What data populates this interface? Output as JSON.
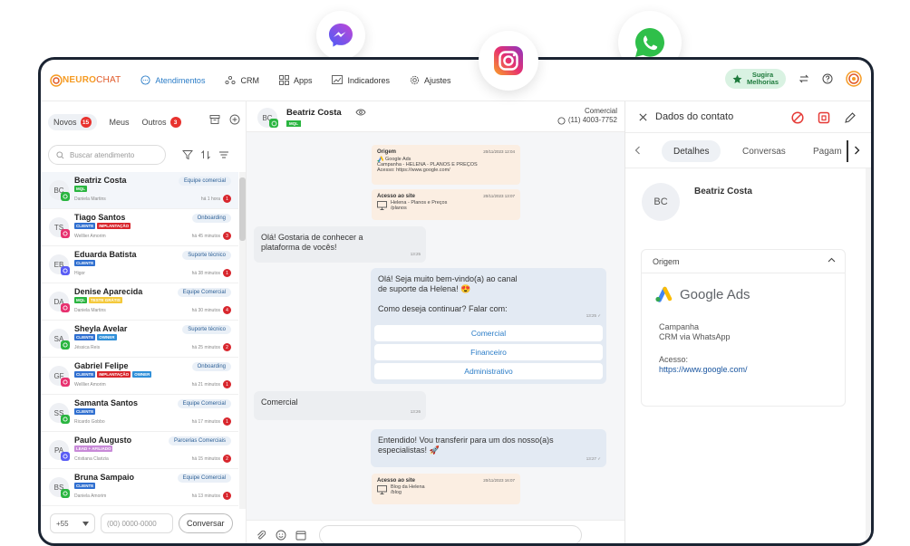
{
  "app": {
    "logo_brand": "NEURO",
    "logo_suffix": "CHAT",
    "nav": {
      "atendimentos": "Atendimentos",
      "crm": "CRM",
      "apps": "Apps",
      "indicadores": "Indicadores",
      "ajustes": "Ajustes"
    },
    "sugira_line1": "Sugira",
    "sugira_line2": "Melhorias"
  },
  "left": {
    "tabs": {
      "novos": "Novos",
      "novos_count": "15",
      "meus": "Meus",
      "outros": "Outros",
      "outros_count": "3"
    },
    "search_placeholder": "Buscar atendimento",
    "conversations": [
      {
        "initials": "BC",
        "name": "Beatriz Costa",
        "tags": [
          {
            "text": "MQL",
            "color": "#2ab540"
          }
        ],
        "agent": "Daniela Martins",
        "team": "Equipe comercial",
        "time": "há 1 hora",
        "count": "1",
        "channel": "whatsapp"
      },
      {
        "initials": "TS",
        "name": "Tiago Santos",
        "tags": [
          {
            "text": "CLIENTE",
            "color": "#2f6fd0"
          },
          {
            "text": "IMPLANTAÇÃO",
            "color": "#d8262d"
          }
        ],
        "agent": "Welllier Amorim",
        "team": "Onboarding",
        "time": "há 45 minutos",
        "count": "3",
        "channel": "instagram"
      },
      {
        "initials": "EB",
        "name": "Eduarda Batista",
        "tags": [
          {
            "text": "CLIENTE",
            "color": "#2f6fd0"
          }
        ],
        "agent": "Higor",
        "team": "Suporte técnico",
        "time": "há 38 minutos",
        "count": "1",
        "channel": "messenger"
      },
      {
        "initials": "DA",
        "name": "Denise Aparecida",
        "tags": [
          {
            "text": "MQL",
            "color": "#2ab540"
          },
          {
            "text": "TESTE GRÁTIS",
            "color": "#f4c93b"
          }
        ],
        "agent": "Daniela Martins",
        "team": "Equipe Comercial",
        "time": "há 30 minutos",
        "count": "4",
        "channel": "instagram"
      },
      {
        "initials": "SA",
        "name": "Sheyla Avelar",
        "tags": [
          {
            "text": "CLIENTE",
            "color": "#2f6fd0"
          },
          {
            "text": "OWNER",
            "color": "#2f8fd8"
          }
        ],
        "agent": "Jéssica Reis",
        "team": "Suporte técnico",
        "time": "há 25 minutos",
        "count": "2",
        "channel": "whatsapp"
      },
      {
        "initials": "GF",
        "name": "Gabriel Felipe",
        "tags": [
          {
            "text": "CLIENTE",
            "color": "#2f6fd0"
          },
          {
            "text": "IMPLANTAÇÃO",
            "color": "#d8262d"
          },
          {
            "text": "OWNER",
            "color": "#2f8fd8"
          }
        ],
        "agent": "Welllier Amorim",
        "team": "Onboarding",
        "time": "há 21 minutos",
        "count": "1",
        "channel": "instagram"
      },
      {
        "initials": "SS",
        "name": "Samanta Santos",
        "tags": [
          {
            "text": "CLIENTE",
            "color": "#2f6fd0"
          }
        ],
        "agent": "Ricardo Gobbo",
        "team": "Equipe Comercial",
        "time": "há 17 minutos",
        "count": "1",
        "channel": "whatsapp"
      },
      {
        "initials": "PA",
        "name": "Paulo Augusto",
        "tags": [
          {
            "text": "LEAD + AFILIADO",
            "color": "#c88ad8"
          }
        ],
        "agent": "Cristiana Clarizia",
        "team": "Parcerias Comerciais",
        "time": "há 15 minutos",
        "count": "2",
        "channel": "messenger"
      },
      {
        "initials": "BS",
        "name": "Bruna Sampaio",
        "tags": [
          {
            "text": "CLIENTE",
            "color": "#2f6fd0"
          }
        ],
        "agent": "Daniela Amorim",
        "team": "Equipe Comercial",
        "time": "há 13 minutos",
        "count": "1",
        "channel": "whatsapp"
      }
    ],
    "ddi": "+55",
    "phone_placeholder": "(00) 0000-0000",
    "conversar": "Conversar"
  },
  "chat": {
    "contact_initials": "BC",
    "contact_name": "Beatriz Costa",
    "contact_tag": "MQL",
    "dept": "Comercial",
    "phone": "(11) 4003-7752",
    "origin_box": {
      "title": "Origem",
      "date": "20/11/2023 12:04",
      "source": "Google Ads",
      "campaign": "Campanha - HELENA - PLANOS E PREÇOS",
      "access": "Acesso: https://www.google.com/"
    },
    "site_box_1": {
      "title": "Acesso ao site",
      "date": "20/11/2023 13:07",
      "line1": "Helena - Planos e Preços",
      "line2": "/planos"
    },
    "msg_in_1": {
      "line1": "Olá! Gostaria de conhecer a",
      "line2": "plataforma de vocês!",
      "time": "13:25"
    },
    "msg_out_1": {
      "line1": "Olá! Seja muito bem-vindo(a) ao canal",
      "line2": "de suporte da Helena! 😍",
      "line3": "Como deseja continuar? Falar com:",
      "time": "13:25 ✓",
      "options": [
        "Comercial",
        "Financeiro",
        "Administrativo"
      ]
    },
    "msg_in_2": {
      "text": "Comercial",
      "time": "13:26"
    },
    "msg_out_2": {
      "line1": "Entendido! Vou transferir para um dos nosso(a)s",
      "line2": "especialistas! 🚀",
      "time": "13:27 ✓"
    },
    "site_box_2": {
      "title": "Acesso ao site",
      "date": "20/11/2023 16:07",
      "line1": "Blog da Helena",
      "line2": "/blog"
    }
  },
  "right": {
    "title": "Dados do contato",
    "tabs": {
      "detalhes": "Detalhes",
      "conversas": "Conversas",
      "pagamentos": "Pagam"
    },
    "contact_initials": "BC",
    "contact_name": "Beatriz Costa",
    "origin": {
      "title": "Origem",
      "source": "Google Ads",
      "campaign_label": "Campanha",
      "campaign_value": "CRM via WhatsApp",
      "access_label": "Acesso:",
      "access_value": "https://www.google.com/"
    }
  },
  "colors": {
    "accent_blue": "#2a7cc7",
    "whatsapp": "#2ab540",
    "badge_red": "#d8262d",
    "frame": "#1b2432"
  },
  "icons": [
    "messenger-icon",
    "instagram-icon",
    "whatsapp-icon",
    "star-icon",
    "swap-icon",
    "help-icon",
    "brand-icon",
    "archive-icon",
    "add-circle-icon",
    "search-icon",
    "filter-icon",
    "sort-icon",
    "menu-icon",
    "eye-icon",
    "phone-icon",
    "close-icon",
    "block-icon",
    "delete-icon",
    "edit-icon",
    "attach-icon",
    "emoji-icon",
    "calendar-icon"
  ]
}
